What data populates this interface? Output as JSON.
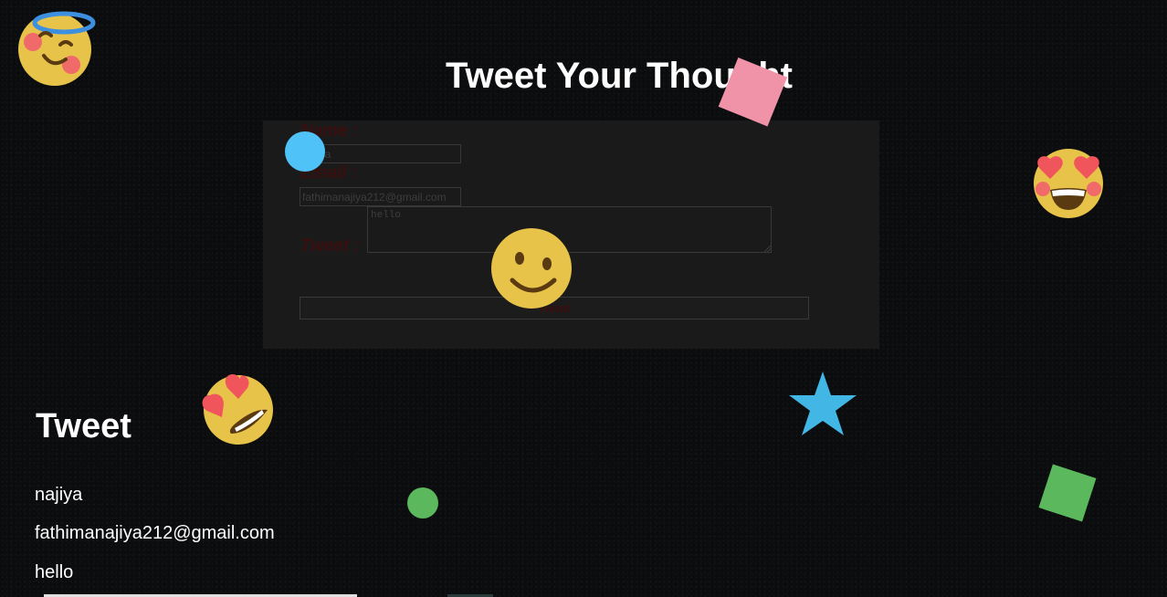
{
  "page": {
    "title": "Tweet Your Thought"
  },
  "form": {
    "name_label": "Name :",
    "name_value": "najiya",
    "email_label": "Email :",
    "email_value": "fathimanajiya212@gmail.com",
    "tweet_label": "Tweet :",
    "tweet_value": "hello",
    "submit_label": "Tweet"
  },
  "output": {
    "heading": "Tweet",
    "name": "najiya",
    "email": "fathimanajiya212@gmail.com",
    "tweet": "hello"
  },
  "decorations": {
    "colors": {
      "background": "#0b0c0e",
      "emoji_yellow": "#f2c94c",
      "blue": "#4fc3f7",
      "pink": "#f48fb1",
      "green": "#66bb6a",
      "red": "#ef5350"
    },
    "icons": [
      "halo-smiley-icon",
      "heart-eyes-emoji-icon",
      "smiley-icon",
      "heart-eyes-emoji-icon",
      "star-icon",
      "circle-icon",
      "square-icon"
    ]
  }
}
